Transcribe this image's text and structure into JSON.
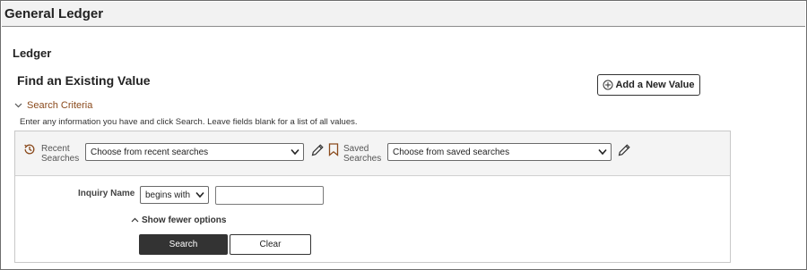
{
  "app": {
    "title": "General Ledger"
  },
  "page": {
    "title": "Ledger",
    "heading": "Find an Existing Value"
  },
  "add_new": {
    "label": "Add a New Value",
    "icon": "plus-circle-icon"
  },
  "search_criteria": {
    "toggle_label": "Search Criteria",
    "instructions": "Enter any information you have and click Search. Leave fields blank for a list of all values.",
    "recent": {
      "label_line1": "Recent",
      "label_line2": "Searches",
      "selected": "Choose from recent searches",
      "icon": "history-icon"
    },
    "saved": {
      "label_line1": "Saved",
      "label_line2": "Searches",
      "selected": "Choose from saved searches",
      "icon": "bookmark-icon"
    },
    "fields": [
      {
        "label": "Inquiry Name",
        "operator": "begins with",
        "value": ""
      }
    ],
    "fewer_options_label": "Show fewer options",
    "search_button": "Search",
    "clear_button": "Clear"
  },
  "colors": {
    "accent": "#8a4a1c",
    "primary_button": "#333333",
    "header_bg": "#f2f2f2",
    "panel_bar_bg": "#f4f4f4"
  }
}
